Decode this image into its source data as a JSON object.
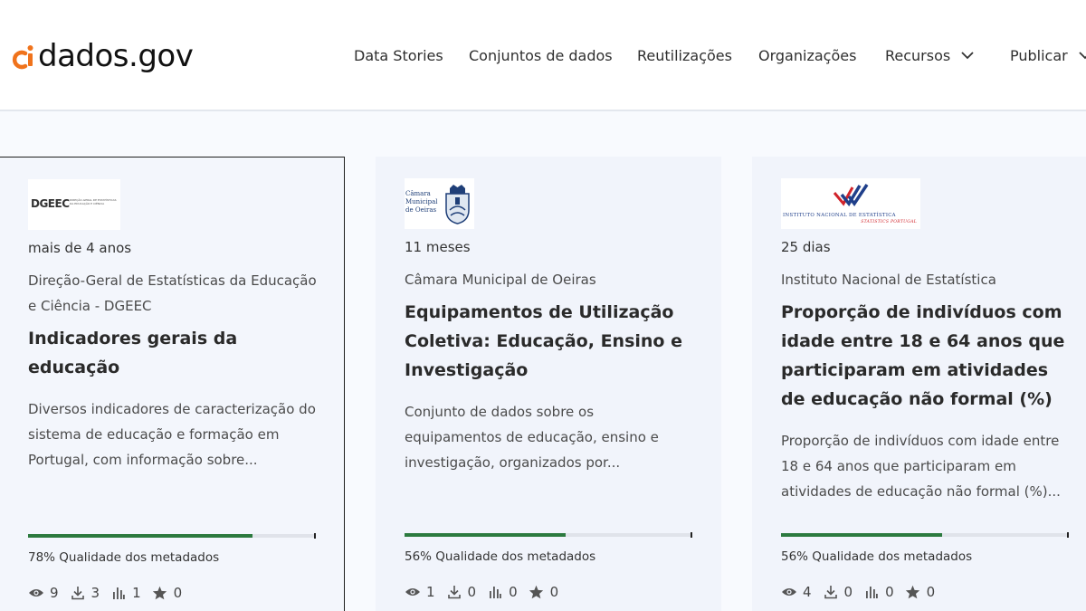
{
  "header": {
    "logo_text": "dados.gov",
    "nav": [
      {
        "label": "Data Stories"
      },
      {
        "label": "Conjuntos de dados"
      },
      {
        "label": "Reutilizações"
      },
      {
        "label": "Organizações"
      },
      {
        "label": "Recursos"
      },
      {
        "label": "Publicar"
      }
    ]
  },
  "colors": {
    "brand_orange": "#f0731c",
    "quality_fill": "#2c7a3f"
  },
  "cards": [
    {
      "org_logo_text": "DGEEC",
      "org_logo_subtext": "DIREÇÃO-GERAL DE ESTATÍSTICAS DA EDUCAÇÃO E CIÊNCIA",
      "when": "mais de 4 anos",
      "organization": "Direção-Geral de Estatísticas da Educação e Ciência - DGEEC",
      "title": "Indicadores gerais da educação",
      "description": "Diversos indicadores de caracterização do sistema de educação e formação em Portugal, com informação sobre...",
      "quality_percent": 78,
      "quality_label": "78% Qualidade dos metadados",
      "views": "9",
      "downloads": "3",
      "reuses": "1",
      "favorites": "0"
    },
    {
      "org_logo_text": "Câmara Municipal de Oeiras",
      "when": "11 meses",
      "organization": "Câmara Municipal de Oeiras",
      "title": "Equipamentos de Utilização Coletiva: Educação, Ensino e Investigação",
      "description": "Conjunto de dados sobre os equipamentos de educação, ensino e investigação, organizados por...",
      "quality_percent": 56,
      "quality_label": "56% Qualidade dos metadados",
      "views": "1",
      "downloads": "0",
      "reuses": "0",
      "favorites": "0"
    },
    {
      "org_logo_text": "INSTITUTO NACIONAL DE ESTATÍSTICA",
      "org_logo_subtext": "STATISTICS PORTUGAL",
      "when": "25 dias",
      "organization": "Instituto Nacional de Estatística",
      "title": "Proporção de indivíduos com idade entre 18 e 64 anos que participaram em atividades de educação não formal (%)",
      "description": "Proporção de indivíduos com idade entre 18 e 64 anos que participaram em atividades de educação não formal (%)...",
      "quality_percent": 56,
      "quality_label": "56% Qualidade dos metadados",
      "views": "4",
      "downloads": "0",
      "reuses": "0",
      "favorites": "0"
    }
  ]
}
